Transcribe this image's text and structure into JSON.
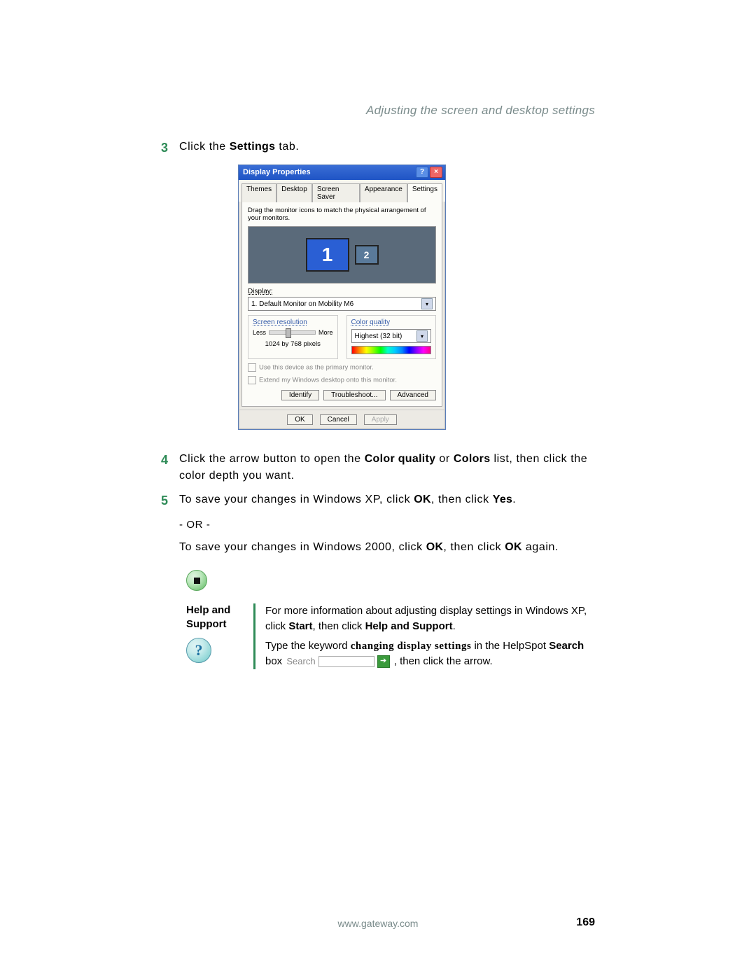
{
  "header": {
    "section": "Adjusting the screen and desktop settings"
  },
  "steps": {
    "s3": {
      "num": "3",
      "pre": "Click the ",
      "bold": "Settings",
      "post": " tab."
    },
    "s4": {
      "num": "4",
      "t1": "Click the arrow button to open the ",
      "b1": "Color quality",
      "t2": " or ",
      "b2": "Colors",
      "t3": " list, then click the color depth you want."
    },
    "s5": {
      "num": "5",
      "t1": "To save your changes in Windows XP, click ",
      "b1": "OK",
      "t2": ", then click ",
      "b2": "Yes",
      "t3": "."
    },
    "or": "- OR -",
    "s5b": {
      "t1": "To save your changes in Windows 2000, click ",
      "b1": "OK",
      "t2": ", then click ",
      "b2": "OK",
      "t3": " again."
    }
  },
  "dialog": {
    "title": "Display Properties",
    "tabs": [
      "Themes",
      "Desktop",
      "Screen Saver",
      "Appearance",
      "Settings"
    ],
    "hint": "Drag the monitor icons to match the physical arrangement of your monitors.",
    "mon1": "1",
    "mon2": "2",
    "displayLabel": "Display:",
    "displayValue": "1. Default Monitor on Mobility M6",
    "resGroup": "Screen resolution",
    "less": "Less",
    "more": "More",
    "resText": "1024 by 768 pixels",
    "colorGroup": "Color quality",
    "colorValue": "Highest (32 bit)",
    "chk1": "Use this device as the primary monitor.",
    "chk2": "Extend my Windows desktop onto this monitor.",
    "btnRow": {
      "identify": "Identify",
      "trouble": "Troubleshoot...",
      "adv": "Advanced"
    },
    "outer": {
      "ok": "OK",
      "cancel": "Cancel",
      "apply": "Apply"
    }
  },
  "help": {
    "heading": "Help and Support",
    "line1a": "For more information about adjusting display settings in Windows XP, click ",
    "b_start": "Start",
    "line1b": ", then click ",
    "b_hns": "Help and Support",
    "line1c": ".",
    "line2a": "Type the keyword ",
    "kw": "changing display settings",
    "line2b": " in the HelpSpot ",
    "b_search": "Search",
    "line2c": " box ",
    "searchLabel": "Search",
    "line2d": ", then click the arrow."
  },
  "footer": {
    "url": "www.gateway.com",
    "page": "169"
  }
}
